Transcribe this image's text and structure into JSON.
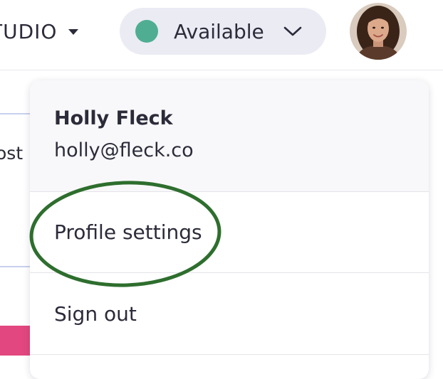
{
  "header": {
    "workspace_name": "TUDIO",
    "status": {
      "label": "Available",
      "dot_color": "#4fae92"
    },
    "avatar_icon": "user-avatar-photo"
  },
  "background": {
    "partial_text": "ost"
  },
  "dropdown": {
    "user": {
      "name": "Holly Fleck",
      "email": "holly@fleck.co"
    },
    "items": [
      {
        "label": "Profile settings",
        "icon": "none"
      },
      {
        "label": "Sign out",
        "icon": "none"
      }
    ]
  },
  "annotation": {
    "highlight_color": "#2e6e2e",
    "highlighted_item": "Profile settings"
  },
  "colors": {
    "accent_pink": "#e2477f",
    "pill_background": "#ebebf4"
  }
}
